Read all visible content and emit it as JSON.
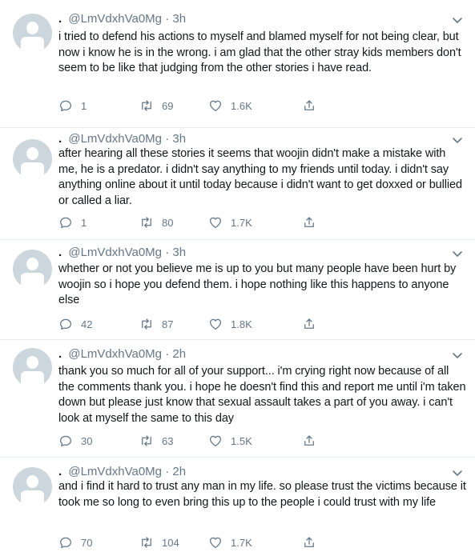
{
  "tweets": [
    {
      "name": ".",
      "handle": "@LmVdxhVa0Mg",
      "time": "3h",
      "text": "i tried to defend his actions to myself and blamed myself for not being clear, but now i know he is in the wrong. i am glad that the other stray kids members don't seem to be like that judging from the other stories i have read.",
      "replies": "1",
      "retweets": "69",
      "likes": "1.6K"
    },
    {
      "name": ".",
      "handle": "@LmVdxhVa0Mg",
      "time": "3h",
      "text": "after hearing all these stories it seems that woojin didn't make a mistake with me, he is a predator. i didn't say anything to my friends until today. i didn't say anything online about it until today because i didn't want to get doxxed or bullied or called a liar.",
      "replies": "1",
      "retweets": "80",
      "likes": "1.7K"
    },
    {
      "name": ".",
      "handle": "@LmVdxhVa0Mg",
      "time": "3h",
      "text": "whether or not you believe me is up to you but many people have been hurt by woojin so i hope you defend them. i hope nothing like this happens to anyone else",
      "replies": "42",
      "retweets": "87",
      "likes": "1.8K"
    },
    {
      "name": ".",
      "handle": "@LmVdxhVa0Mg",
      "time": "2h",
      "text": "thank you so much for all of your support... i'm crying right now because of all the comments thank you. i hope he doesn't find this and report me until i'm taken down but please just know that sexual assault takes a part of you away. i can't look at myself the same to this day",
      "replies": "30",
      "retweets": "63",
      "likes": "1.5K"
    },
    {
      "name": ".",
      "handle": "@LmVdxhVa0Mg",
      "time": "2h",
      "text": "and i find it hard to trust any man in my life. so please trust the victims because it took me so long to even bring this up to the people i could trust with my life",
      "replies": "70",
      "retweets": "104",
      "likes": "1.7K"
    }
  ],
  "colors": {
    "text": "#14171a",
    "secondary": "#657786",
    "avatar_bg": "#ccd6dd",
    "divider": "#e6ecf0"
  },
  "icons": {
    "reply": "reply-icon",
    "retweet": "retweet-icon",
    "like": "heart-icon",
    "share": "share-icon",
    "menu": "chevron-down-icon"
  }
}
